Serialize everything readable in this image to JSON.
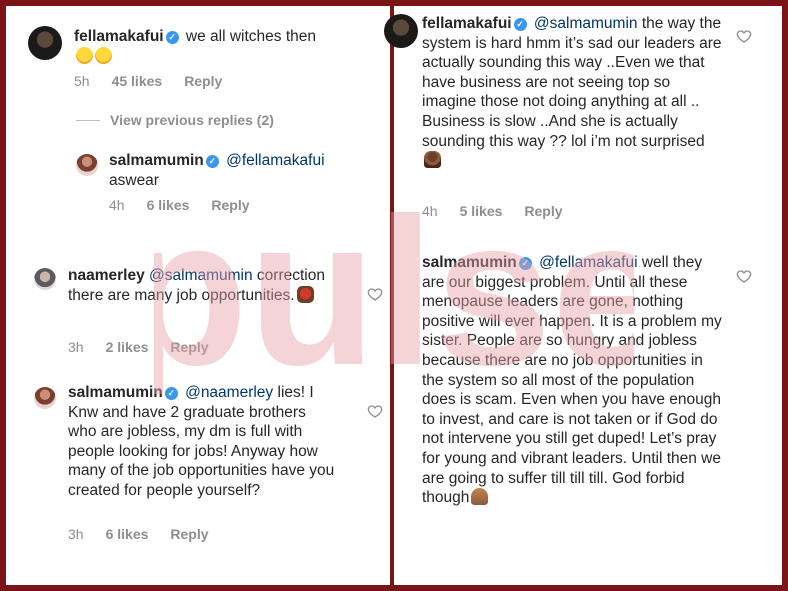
{
  "left": {
    "c1": {
      "user": "fellamakafui",
      "text": "we all witches then",
      "time": "5h",
      "likes": "45 likes",
      "reply": "Reply"
    },
    "view_previous": "View previous replies (2)",
    "c2": {
      "user": "salmamumin",
      "mention": "@fellamakafui",
      "text": "aswear",
      "time": "4h",
      "likes": "6 likes",
      "reply": "Reply"
    },
    "c3": {
      "user": "naamerley",
      "mention": "@salmamumin",
      "text": "correction there are many job opportunities.",
      "time": "3h",
      "likes": "2 likes",
      "reply": "Reply"
    },
    "c4": {
      "user": "salmamumin",
      "mention": "@naamerley",
      "text": "lies! I Knw and have 2 graduate brothers who are jobless, my dm is full with people looking for jobs! Anyway how many of the job opportunities have you created for people yourself?",
      "time": "3h",
      "likes": "6 likes",
      "reply": "Reply"
    }
  },
  "right": {
    "c1": {
      "user": "fellamakafui",
      "mention": "@salmamumin",
      "text": "the way the system is hard hmm it’s sad our leaders are actually sounding this way ..Even we that have business are not seeing top so imagine those not doing anything at all .. Business is slow ..And she is actually sounding this way ?? lol i’m not surprised",
      "time": "4h",
      "likes": "5 likes",
      "reply": "Reply"
    },
    "c2": {
      "user": "salmamumin",
      "mention": "@fellamakafui",
      "text": "well they are our biggest problem. Until all these menopause leaders are gone, nothing positive will ever happen. It is a problem my sister. People are so hungry and jobless because there are no job opportunities in the system so all most of the population does is scam. Even when you have enough to invest, and care is not taken or if God do not intervene you still get duped! Let’s pray for young and vibrant leaders. Until then we are going to suffer till till till. God forbid though"
    }
  },
  "watermark": "pulse",
  "colors": {
    "frame": "#7a1416",
    "mention": "#00376b",
    "meta": "#8e8e8e",
    "watermark": "#e8a2a6"
  }
}
